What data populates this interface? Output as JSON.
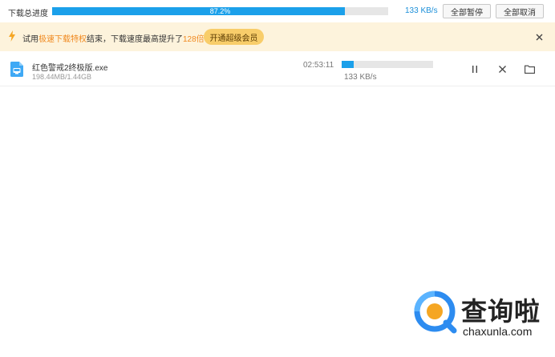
{
  "topbar": {
    "title": "下载总进度",
    "progress_percent": 87.2,
    "progress_label": "87.2%",
    "speed": "133 KB/s",
    "pause_all_label": "全部暂停",
    "cancel_all_label": "全部取消"
  },
  "notice": {
    "icon": "lightning-icon",
    "text_prefix": "试用",
    "text_highlight1": "极速下载特权",
    "text_middle": "结束，下载速度最高提升了",
    "text_highlight2": "128倍",
    "text_suffix": "！",
    "vip_button_label": "开通超级会员",
    "close_icon": "close-icon"
  },
  "download": {
    "file_name": "红色警戒2终极版.exe",
    "file_size": "198.44MB/1.44GB",
    "time_remaining": "02:53:11",
    "progress_fraction": 0.13,
    "speed": "133 KB/s",
    "actions": [
      "pause-icon",
      "close-icon",
      "folder-icon"
    ]
  },
  "watermark": {
    "text_cn": "查询啦",
    "text_en": "chaxunla.com"
  },
  "colors": {
    "progress": "#1ba0ea",
    "notice_bg": "#fdf3dc",
    "highlight": "#f0891f",
    "vip_button": "#f8cd6a",
    "watermark_blue": "#2d8cf0",
    "watermark_orange": "#f5a623"
  }
}
